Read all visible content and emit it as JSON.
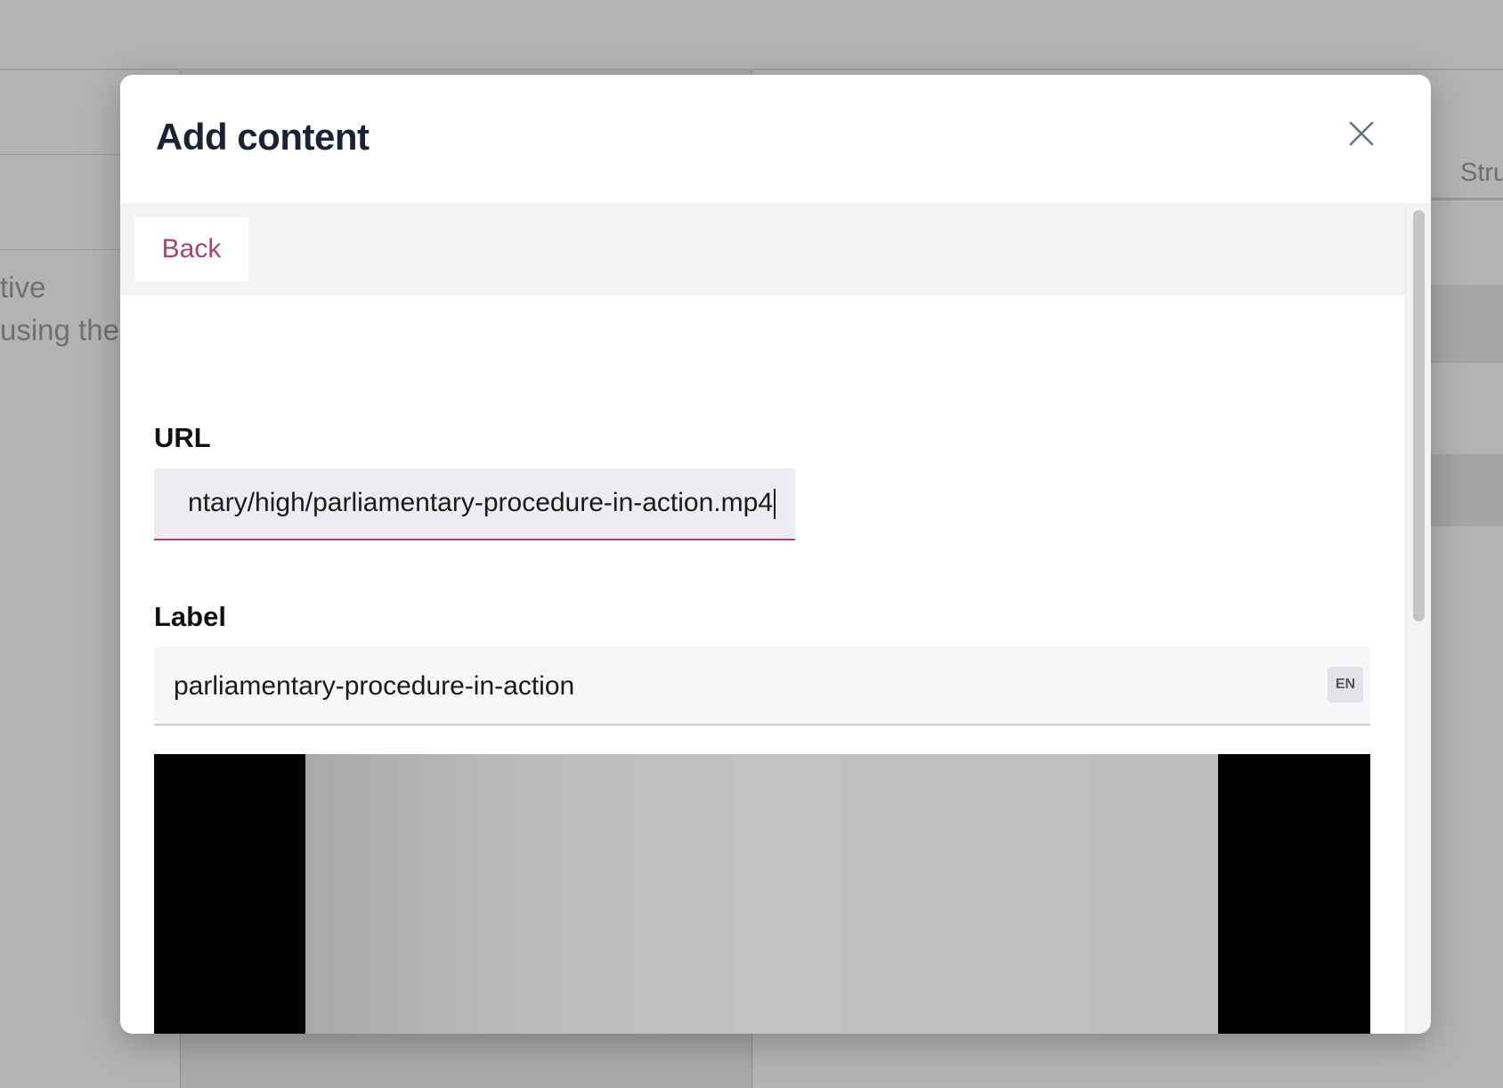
{
  "background": {
    "partial_text_line1": "tive",
    "partial_text_line2": "using the",
    "partial_tab": "Stru"
  },
  "modal": {
    "title": "Add content",
    "close_icon": "close-icon",
    "back_label": "Back",
    "url": {
      "label": "URL",
      "visible_value": "ntary/high/parliamentary-procedure-in-action.mp4"
    },
    "label_field": {
      "label": "Label",
      "value": "parliamentary-procedure-in-action",
      "language_badge": "EN"
    }
  },
  "colors": {
    "accent": "#a8456b",
    "title": "#1a2233",
    "overlay": "#b3b3b3"
  }
}
